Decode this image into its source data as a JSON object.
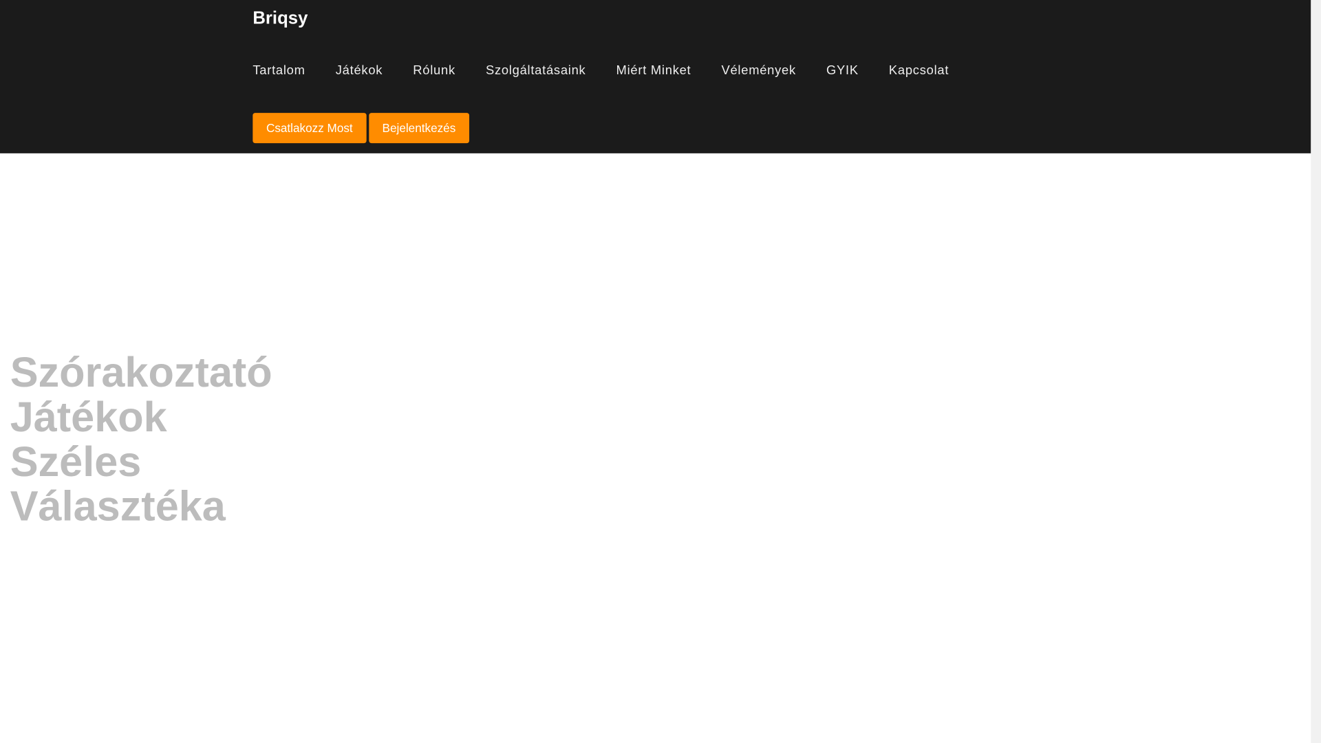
{
  "brand": "Briqsy",
  "nav": [
    "Tartalom",
    "Játékok",
    "Rólunk",
    "Szolgáltatásaink",
    "Miért Minket",
    "Vélemények",
    "GYIK",
    "Kapcsolat"
  ],
  "buttons": {
    "join": "Csatlakozz Most",
    "login": "Bejelentkezés"
  },
  "hero": {
    "title": "Szórakoztató Játékok Széles Választéka"
  },
  "colors": {
    "header": "#1b1b1b",
    "accent": "#ff8c00"
  }
}
